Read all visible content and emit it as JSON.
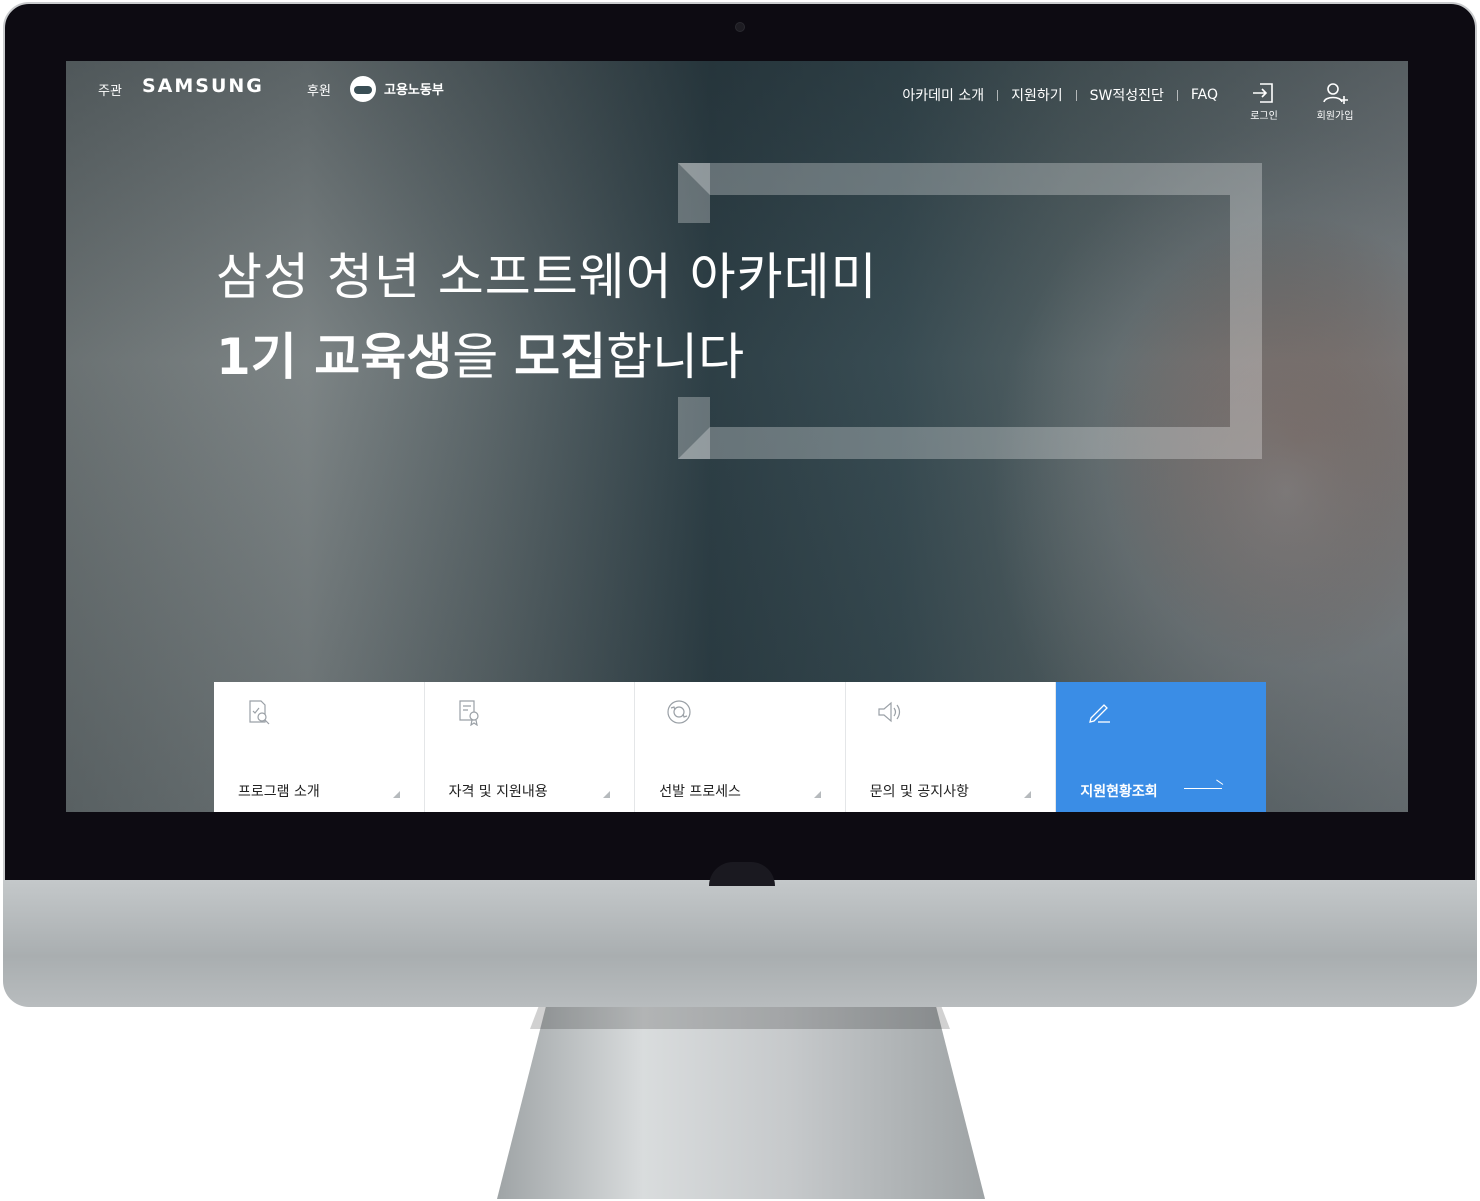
{
  "header": {
    "host_label": "주관",
    "host_logo": "SAMSUNG",
    "sponsor_label": "후원",
    "sponsor_name": "고용노동부",
    "nav": [
      {
        "label": "아카데미 소개"
      },
      {
        "label": "지원하기"
      },
      {
        "label": "SW적성진단"
      },
      {
        "label": "FAQ"
      }
    ],
    "login_label": "로그인",
    "signup_label": "회원가입"
  },
  "hero": {
    "line1": "삼성 청년 소프트웨어 아카데미",
    "line2_bold1": "1기 교육생",
    "line2_light1": "을 ",
    "line2_bold2": "모집",
    "line2_light2": "합니다"
  },
  "quick_menu": [
    {
      "label": "프로그램 소개",
      "icon": "document-search-icon"
    },
    {
      "label": "자격 및 지원내용",
      "icon": "certificate-icon"
    },
    {
      "label": "선발 프로세스",
      "icon": "process-cycle-icon"
    },
    {
      "label": "문의 및 공지사항",
      "icon": "speaker-icon"
    },
    {
      "label": "지원현황조회",
      "icon": "pencil-icon"
    }
  ],
  "colors": {
    "primary": "#3a8de6"
  }
}
